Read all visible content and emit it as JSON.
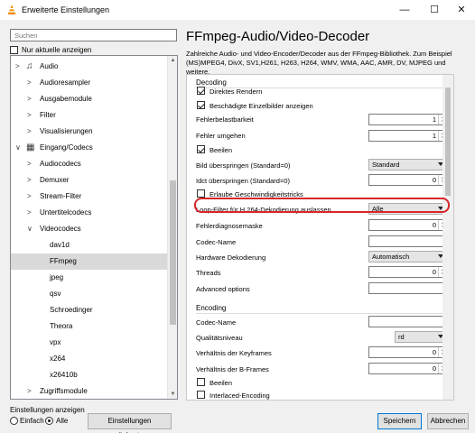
{
  "window": {
    "title": "Erweiterte Einstellungen",
    "minimize": "—",
    "maximize": "☐",
    "close": "✕"
  },
  "sidebar": {
    "search_placeholder": "Suchen",
    "only_current_label": "Nur aktuelle anzeigen",
    "tree": [
      {
        "label": "Audio",
        "level": 0,
        "state": "collapsed",
        "icon": "music-note-icon"
      },
      {
        "label": "Audioresampler",
        "level": 1,
        "state": "collapsed"
      },
      {
        "label": "Ausgabemodule",
        "level": 1,
        "state": "collapsed"
      },
      {
        "label": "Filter",
        "level": 1,
        "state": "collapsed"
      },
      {
        "label": "Visualisierungen",
        "level": 1,
        "state": "collapsed"
      },
      {
        "label": "Eingang/Codecs",
        "level": 0,
        "state": "expanded",
        "icon": "codec-icon"
      },
      {
        "label": "Audiocodecs",
        "level": 1,
        "state": "collapsed"
      },
      {
        "label": "Demuxer",
        "level": 1,
        "state": "collapsed"
      },
      {
        "label": "Stream-Filter",
        "level": 1,
        "state": "collapsed"
      },
      {
        "label": "Untertitelcodecs",
        "level": 1,
        "state": "collapsed"
      },
      {
        "label": "Videocodecs",
        "level": 1,
        "state": "expanded"
      },
      {
        "label": "dav1d",
        "level": 2
      },
      {
        "label": "FFmpeg",
        "level": 2,
        "selected": true
      },
      {
        "label": "jpeg",
        "level": 2
      },
      {
        "label": "qsv",
        "level": 2
      },
      {
        "label": "Schroedinger",
        "level": 2
      },
      {
        "label": "Theora",
        "level": 2
      },
      {
        "label": "vpx",
        "level": 2
      },
      {
        "label": "x264",
        "level": 2
      },
      {
        "label": "x26410b",
        "level": 2
      },
      {
        "label": "Zugriffsmodule",
        "level": 1,
        "state": "collapsed"
      }
    ],
    "show_settings_label": "Einstellungen anzeigen",
    "radio_simple": "Einfach",
    "radio_all": "Alle",
    "reset_button": "Einstellungen zurücksetzen"
  },
  "main": {
    "heading": "FFmpeg-Audio/Video-Decoder",
    "description": "Zahlreiche Audio- und Video-Encoder/Decoder aus der FFmpeg-Bibliothek. Zum Beispiel (MS)MPEG4, DivX, SV1,H261, H263, H264, WMV, WMA, AAC, AMR, DV, MJPEG und weitere.",
    "decoding": {
      "title": "Decoding",
      "direct_render": "Direktes Rendern",
      "show_corrupted": "Beschädigte Einzelbilder anzeigen",
      "error_resilience": "Fehlerbelastbarkeit",
      "error_resilience_value": "1",
      "workaround_bugs": "Fehler umgehen",
      "workaround_bugs_value": "1",
      "hurry_up": "Beeilen",
      "skip_frame": "Bild überspringen (Standard=0)",
      "skip_frame_value": "Standard",
      "skip_idct": "Idct überspringen (Standard=0)",
      "skip_idct_value": "0",
      "allow_speed_tricks": "Erlaube Geschwindigkeitstricks",
      "loop_filter": "Loop-Filter für H.264-Dekodierung auslassen",
      "loop_filter_value": "Alle",
      "debug_mask": "Fehlerdiagnosemaske",
      "debug_mask_value": "0",
      "codec_name": "Codec-Name",
      "hw_decoding": "Hardware Dekodierung",
      "hw_decoding_value": "Automatisch",
      "threads": "Threads",
      "threads_value": "0",
      "advanced_options": "Advanced options"
    },
    "encoding": {
      "title": "Encoding",
      "codec_name": "Codec-Name",
      "quality": "Qualitätsniveau",
      "quality_value": "rd",
      "keyframe_ratio": "Verhältnis der Keyframes",
      "keyframe_ratio_value": "0",
      "bframe_ratio": "Verhältnis der B-Frames",
      "bframe_ratio_value": "0",
      "hurry_up": "Beeilen",
      "interlaced": "Interlaced-Encoding"
    }
  },
  "footer": {
    "save": "Speichern",
    "cancel": "Abbrechen"
  },
  "colors": {
    "highlight": "#d8262b",
    "selection": "#d9d9d9",
    "primary_border": "#0078d7"
  }
}
